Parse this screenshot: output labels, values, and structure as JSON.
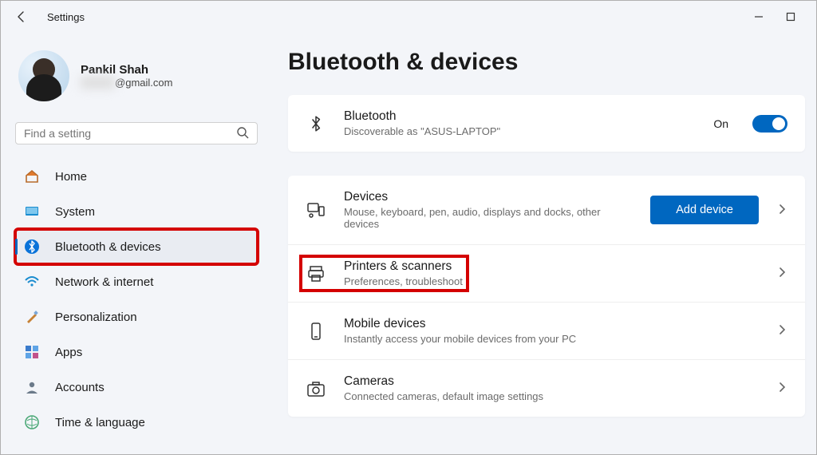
{
  "window": {
    "title": "Settings"
  },
  "user": {
    "name": "Pankil Shah",
    "email_hidden": "hidden",
    "email_suffix": "@gmail.com"
  },
  "search": {
    "placeholder": "Find a setting"
  },
  "nav": {
    "home": "Home",
    "system": "System",
    "bluetooth": "Bluetooth & devices",
    "network": "Network & internet",
    "personalization": "Personalization",
    "apps": "Apps",
    "accounts": "Accounts",
    "time": "Time & language"
  },
  "page": {
    "title": "Bluetooth & devices"
  },
  "bluetooth": {
    "title": "Bluetooth",
    "sub": "Discoverable as \"ASUS-LAPTOP\"",
    "state_label": "On"
  },
  "devices": {
    "title": "Devices",
    "sub": "Mouse, keyboard, pen, audio, displays and docks, other devices",
    "button": "Add device"
  },
  "printers": {
    "title": "Printers & scanners",
    "sub": "Preferences, troubleshoot"
  },
  "mobile": {
    "title": "Mobile devices",
    "sub": "Instantly access your mobile devices from your PC"
  },
  "cameras": {
    "title": "Cameras",
    "sub": "Connected cameras, default image settings"
  }
}
